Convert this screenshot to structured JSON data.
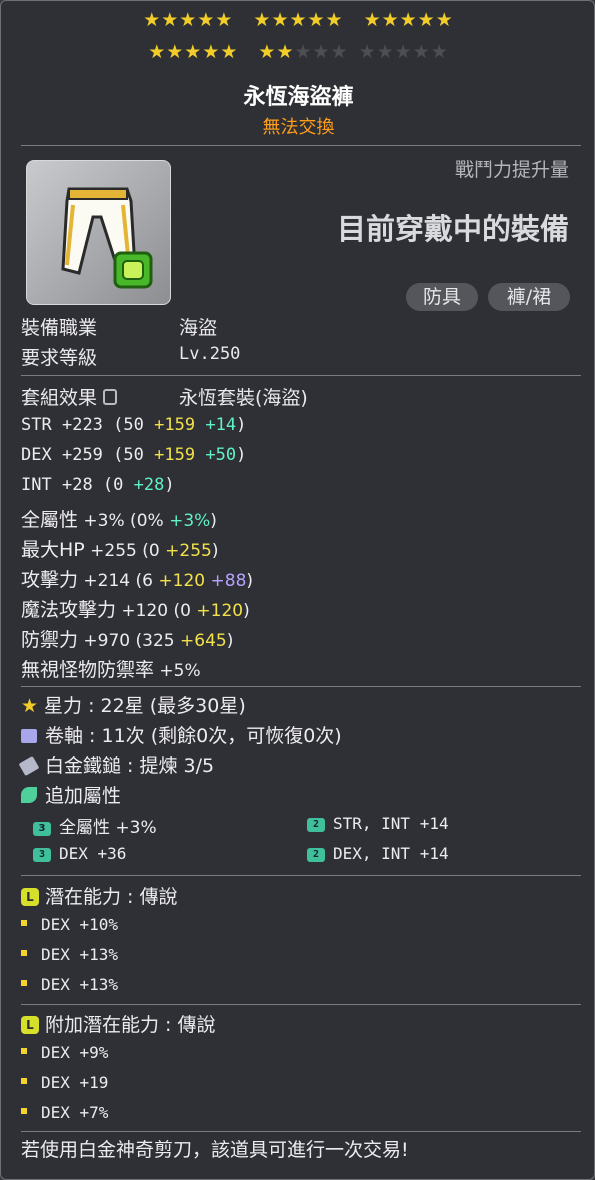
{
  "stars": {
    "row1": [
      "★★★★★",
      "★★★★★",
      "★★★★★"
    ],
    "row2_on": [
      "★★★★★",
      "★★"
    ],
    "row2_off": [
      "★★★",
      "★★★★★"
    ]
  },
  "item": {
    "name": "永恆海盜褲",
    "trade_status": "無法交換"
  },
  "header": {
    "combat_power_label": "戰鬥力提升量",
    "equipped_label": "目前穿戴中的裝備",
    "tags": [
      "防具",
      "褲/裙"
    ]
  },
  "requirements": {
    "job_label": "裝備職業",
    "job_value": "海盜",
    "level_label": "要求等級",
    "level_value": "Lv.250"
  },
  "set": {
    "label": "套組效果",
    "value": "永恆套裝(海盜)"
  },
  "stats": [
    {
      "name": "STR",
      "total": "+223",
      "base": "50",
      "add1": "+159",
      "add2": "+14"
    },
    {
      "name": "DEX",
      "total": "+259",
      "base": "50",
      "add1": "+159",
      "add2": "+50"
    },
    {
      "name": "INT",
      "total": "+28",
      "base": "0",
      "add2": "+28"
    },
    {
      "name": "全屬性",
      "total": "+3%",
      "base": "0%",
      "add2": "+3%"
    },
    {
      "name": "最大HP",
      "total": "+255",
      "base": "0",
      "add1": "+255"
    },
    {
      "name": "攻擊力",
      "total": "+214",
      "base": "6",
      "add1": "+120",
      "add3": "+88"
    },
    {
      "name": "魔法攻擊力",
      "total": "+120",
      "base": "0",
      "add1": "+120"
    },
    {
      "name": "防禦力",
      "total": "+970",
      "base": "325",
      "add1": "+645"
    },
    {
      "name": "無視怪物防禦率",
      "total": "+5%"
    }
  ],
  "upgrades": {
    "star_label": "星力",
    "star_value": "22星 (最多30星)",
    "scroll_label": "卷軸",
    "scroll_value": "11次 (剩餘0次，可恢復0次)",
    "hammer_label": "白金鐵鎚",
    "hammer_value": "提煉 3/5",
    "bonus_label": "追加屬性"
  },
  "bonus_stats": [
    {
      "badge": "3",
      "text": "全屬性 +3%"
    },
    {
      "badge": "2",
      "text": "STR, INT  +14"
    },
    {
      "badge": "3",
      "text": "DEX  +36"
    },
    {
      "badge": "2",
      "text": "DEX, INT  +14"
    }
  ],
  "potential": {
    "badge": "L",
    "label": "潛在能力 : 傳說",
    "lines": [
      "DEX +10%",
      "DEX +13%",
      "DEX +13%"
    ]
  },
  "additional_potential": {
    "badge": "L",
    "label": "附加潛在能力 : 傳說",
    "lines": [
      "DEX +9%",
      "DEX +19",
      "DEX +7%"
    ]
  },
  "footer": {
    "note": "若使用白金神奇剪刀，該道具可進行一次交易!"
  },
  "colors": {
    "star": "#f2cd2a",
    "untradable": "#ff9e1b",
    "yellow_bonus": "#f2e14a",
    "green_bonus": "#5ff2c4",
    "purple_bonus": "#b7a2ff",
    "legend_badge": "#d6e02a"
  }
}
